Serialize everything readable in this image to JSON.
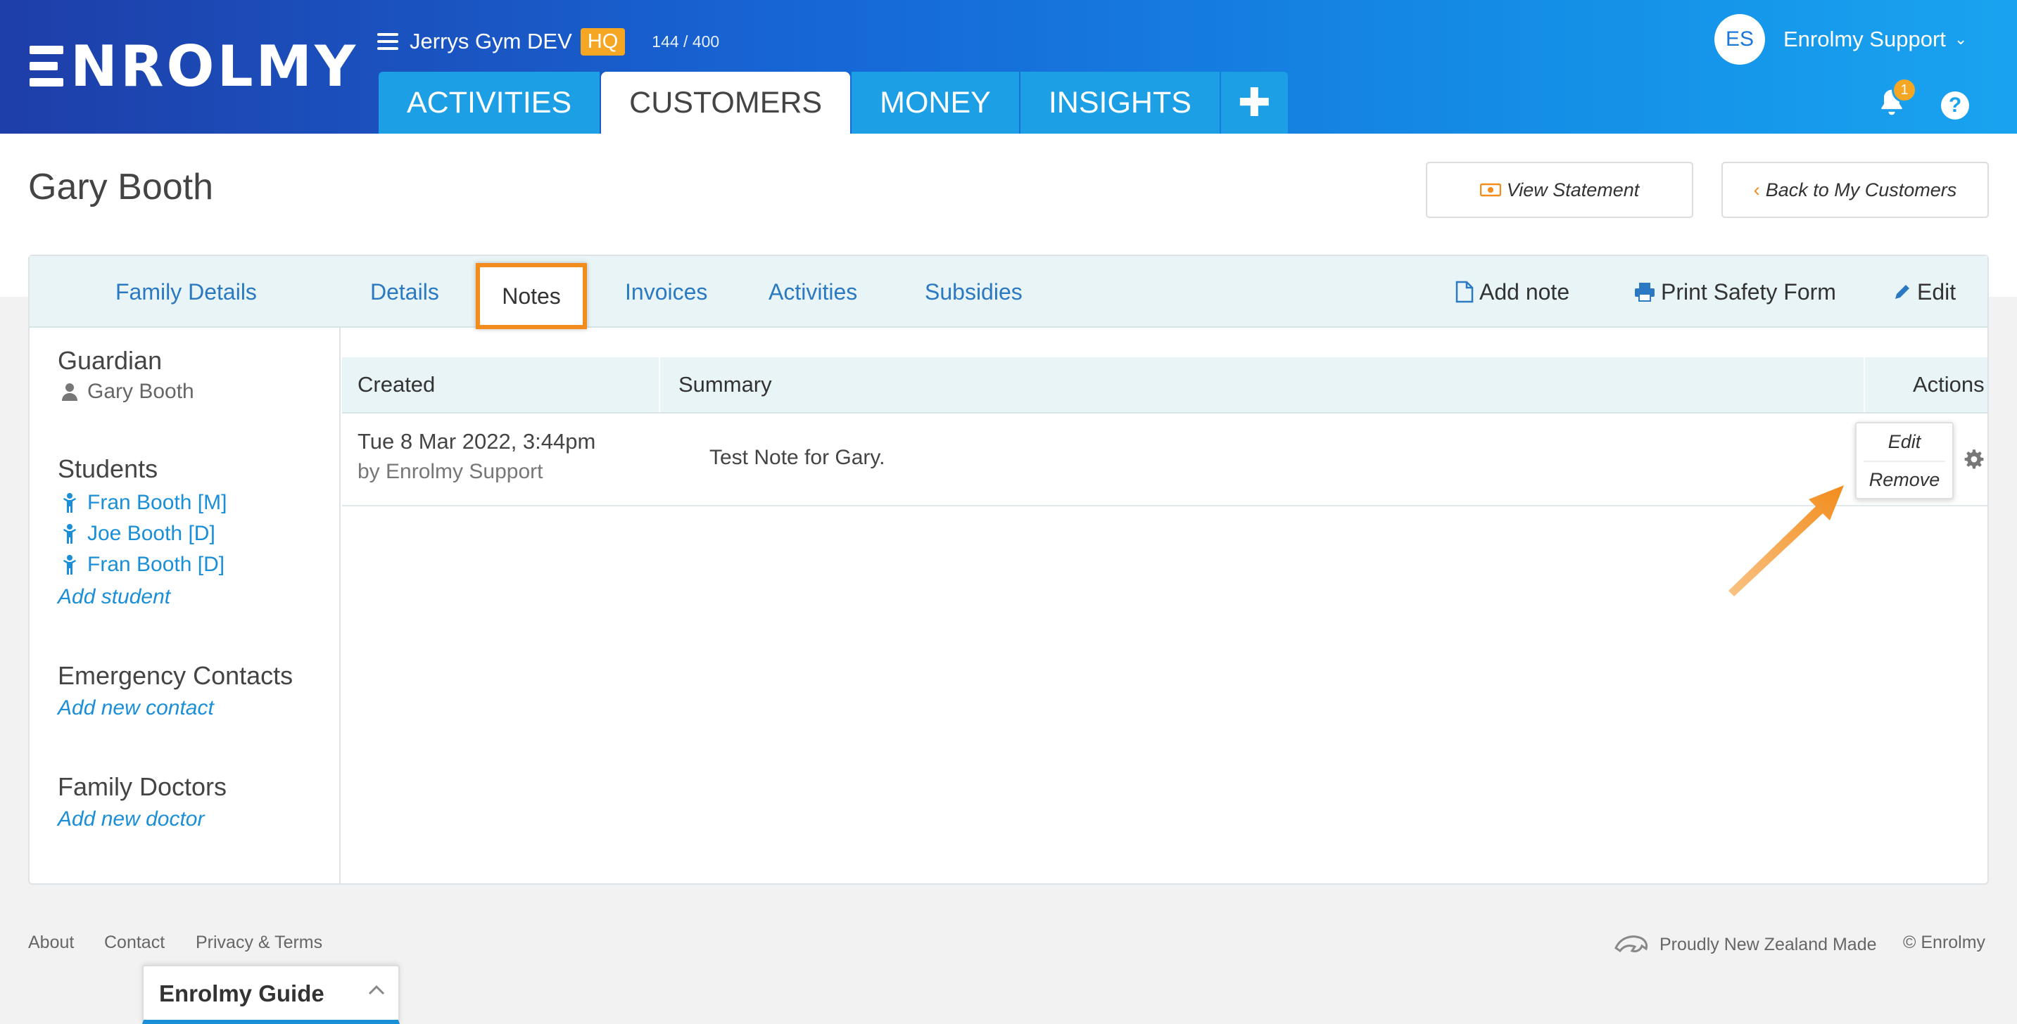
{
  "brand": {
    "logo_text": "NROLMY"
  },
  "org": {
    "name": "Jerrys Gym DEV",
    "badge": "HQ",
    "count": "144 / 400"
  },
  "nav": {
    "tabs": [
      {
        "label": "ACTIVITIES"
      },
      {
        "label": "CUSTOMERS"
      },
      {
        "label": "MONEY"
      },
      {
        "label": "INSIGHTS"
      }
    ],
    "plus_label": "✚"
  },
  "user": {
    "initials": "ES",
    "name": "Enrolmy Support",
    "chevron": "⌄"
  },
  "notifications": {
    "count": "1"
  },
  "help": {
    "label": "?"
  },
  "page": {
    "title": "Gary Booth"
  },
  "actions": {
    "view_statement": "View Statement",
    "back": "Back to My Customers"
  },
  "tabs": {
    "family_details": "Family Details",
    "details": "Details",
    "notes": "Notes",
    "invoices": "Invoices",
    "activities": "Activities",
    "subsidies": "Subsidies",
    "add_note": "Add note",
    "print_safety": "Print Safety Form",
    "edit": "Edit"
  },
  "sidebar": {
    "guardian_heading": "Guardian",
    "guardian_name": "Gary Booth",
    "students_heading": "Students",
    "students": [
      {
        "name": "Fran Booth [M]"
      },
      {
        "name": "Joe Booth [D]"
      },
      {
        "name": "Fran Booth [D]"
      }
    ],
    "add_student": "Add student",
    "emergency_heading": "Emergency Contacts",
    "add_contact": "Add new contact",
    "doctors_heading": "Family Doctors",
    "add_doctor": "Add new doctor"
  },
  "notes_table": {
    "headers": {
      "created": "Created",
      "summary": "Summary",
      "actions": "Actions"
    },
    "rows": [
      {
        "created": "Tue 8 Mar 2022, 3:44pm",
        "by": "by Enrolmy Support",
        "summary": "Test Note for Gary."
      }
    ],
    "menu": {
      "edit": "Edit",
      "remove": "Remove"
    }
  },
  "footer": {
    "about": "About",
    "contact": "Contact",
    "privacy": "Privacy & Terms",
    "nz_made": "Proudly New Zealand Made",
    "copyright": "© Enrolmy"
  },
  "guide": {
    "title": "Enrolmy Guide"
  },
  "colors": {
    "accent_orange": "#f28c1c",
    "link_blue": "#2b79c2",
    "header_blue": "#1766d6",
    "badge_orange": "#f5a623"
  },
  "icons": [
    "menu-icon",
    "bell-icon",
    "help-icon",
    "money-icon",
    "chevron-left-icon",
    "file-icon",
    "printer-icon",
    "pencil-icon",
    "user-icon",
    "child-icon",
    "gear-icon",
    "chevron-up-icon",
    "nz-map-icon"
  ]
}
